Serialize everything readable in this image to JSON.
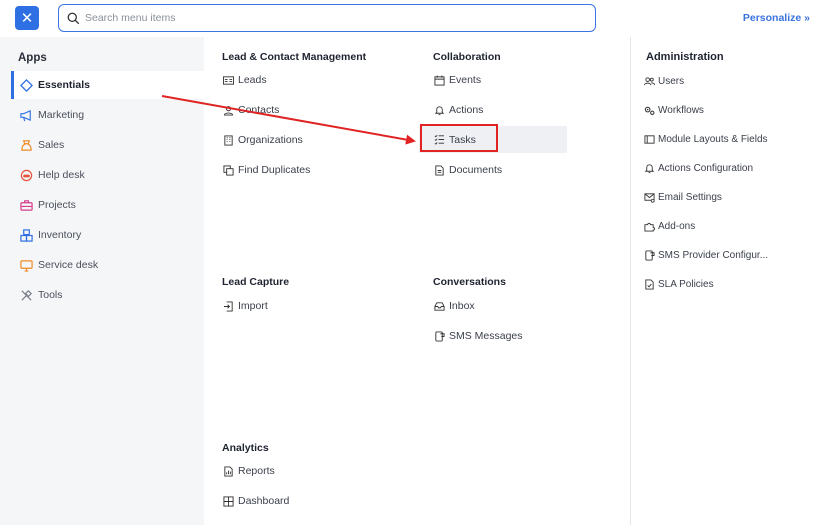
{
  "topbar": {
    "close_label": "✕",
    "search_placeholder": "Search menu items",
    "personalize_label": "Personalize »"
  },
  "apps": {
    "title": "Apps",
    "items": [
      {
        "label": "Essentials",
        "icon": "diamond-icon",
        "color": "#2f6fe4"
      },
      {
        "label": "Marketing",
        "icon": "megaphone-icon",
        "color": "#2f6fe4"
      },
      {
        "label": "Sales",
        "icon": "sales-icon",
        "color": "#f08a24"
      },
      {
        "label": "Help desk",
        "icon": "helpdesk-icon",
        "color": "#e5533c"
      },
      {
        "label": "Projects",
        "icon": "briefcase-icon",
        "color": "#d63c8c"
      },
      {
        "label": "Inventory",
        "icon": "boxes-icon",
        "color": "#2f6fe4"
      },
      {
        "label": "Service desk",
        "icon": "monitor-icon",
        "color": "#f08a24"
      },
      {
        "label": "Tools",
        "icon": "tools-icon",
        "color": "#7a7f8a"
      }
    ]
  },
  "lead_contact": {
    "title": "Lead & Contact Management",
    "items": [
      "Leads",
      "Contacts",
      "Organizations",
      "Find Duplicates"
    ]
  },
  "collaboration": {
    "title": "Collaboration",
    "items": [
      "Events",
      "Actions",
      "Tasks",
      "Documents"
    ]
  },
  "lead_capture": {
    "title": "Lead Capture",
    "items": [
      "Import"
    ]
  },
  "conversations": {
    "title": "Conversations",
    "items": [
      "Inbox",
      "SMS Messages"
    ]
  },
  "analytics": {
    "title": "Analytics",
    "items": [
      "Reports",
      "Dashboard"
    ]
  },
  "administration": {
    "title": "Administration",
    "items": [
      "Users",
      "Workflows",
      "Module Layouts & Fields",
      "Actions Configuration",
      "Email Settings",
      "Add-ons",
      "SMS Provider Configur...",
      "SLA Policies"
    ]
  },
  "colors": {
    "accent": "#2f6fe4",
    "annotation_red": "#e02424"
  }
}
